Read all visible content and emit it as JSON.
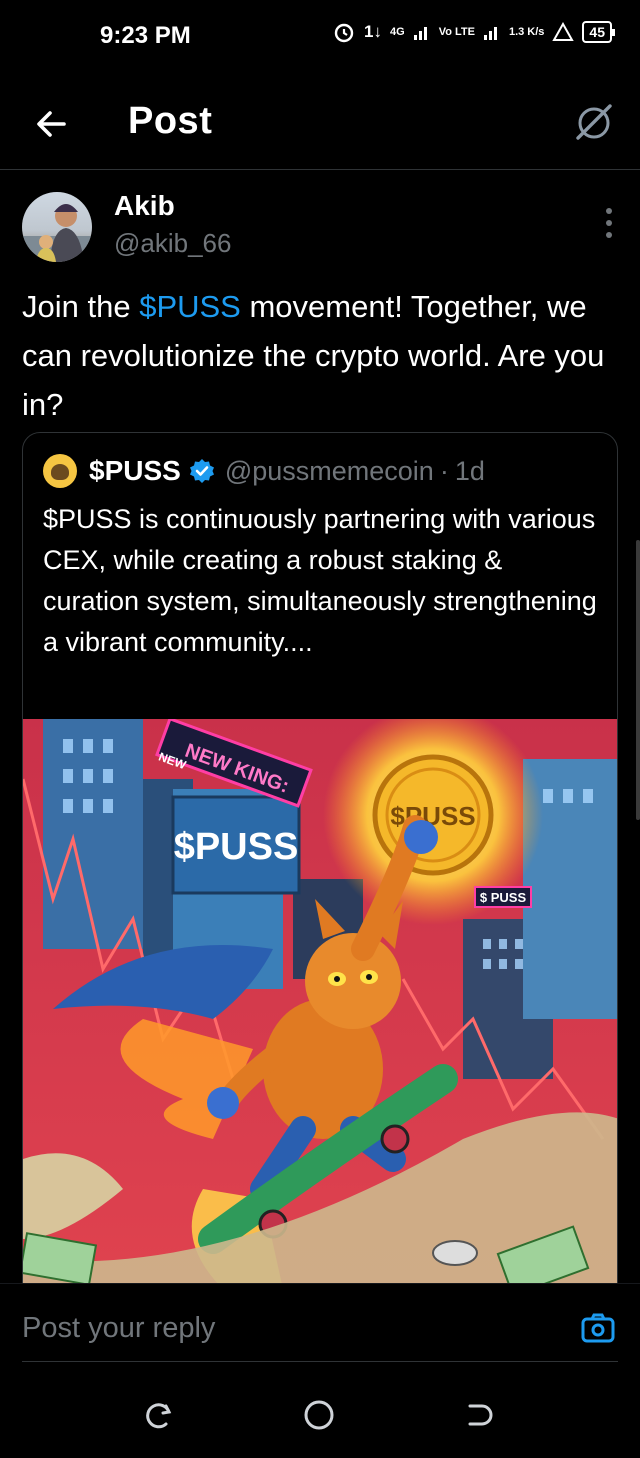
{
  "status_bar": {
    "time": "9:23 PM",
    "network_1": "4G",
    "network_2": "Vo LTE",
    "speed": "1.3 K/s",
    "battery": "45"
  },
  "header": {
    "title": "Post"
  },
  "post": {
    "author_name": "Akib",
    "author_handle": "@akib_66",
    "text_before": "Join the ",
    "cashtag": "$PUSS",
    "text_after": " movement! Together, we can revolutionize the crypto world. Are you in?"
  },
  "quoted_post": {
    "name": "$PUSS",
    "handle": "@pussmemecoin",
    "separator": "·",
    "time": "1d",
    "text": "$PUSS is continuously partnering with various CEX, while creating a robust staking & curation system, simultaneously strengthening a vibrant community....",
    "image_texts": {
      "new_badge": "NEW",
      "banner": "NEW KING:",
      "billboard": "$PUSS",
      "coin": "$PUSS",
      "sign": "$ PUSS"
    }
  },
  "reply": {
    "placeholder": "Post your reply"
  },
  "colors": {
    "accent": "#1d9bf0",
    "background": "#000000",
    "muted": "#71767b"
  },
  "icons": [
    "back-arrow-icon",
    "grok-icon",
    "more-vertical-icon",
    "verified-badge-icon",
    "camera-icon",
    "recents-icon",
    "home-icon",
    "back-nav-icon"
  ]
}
